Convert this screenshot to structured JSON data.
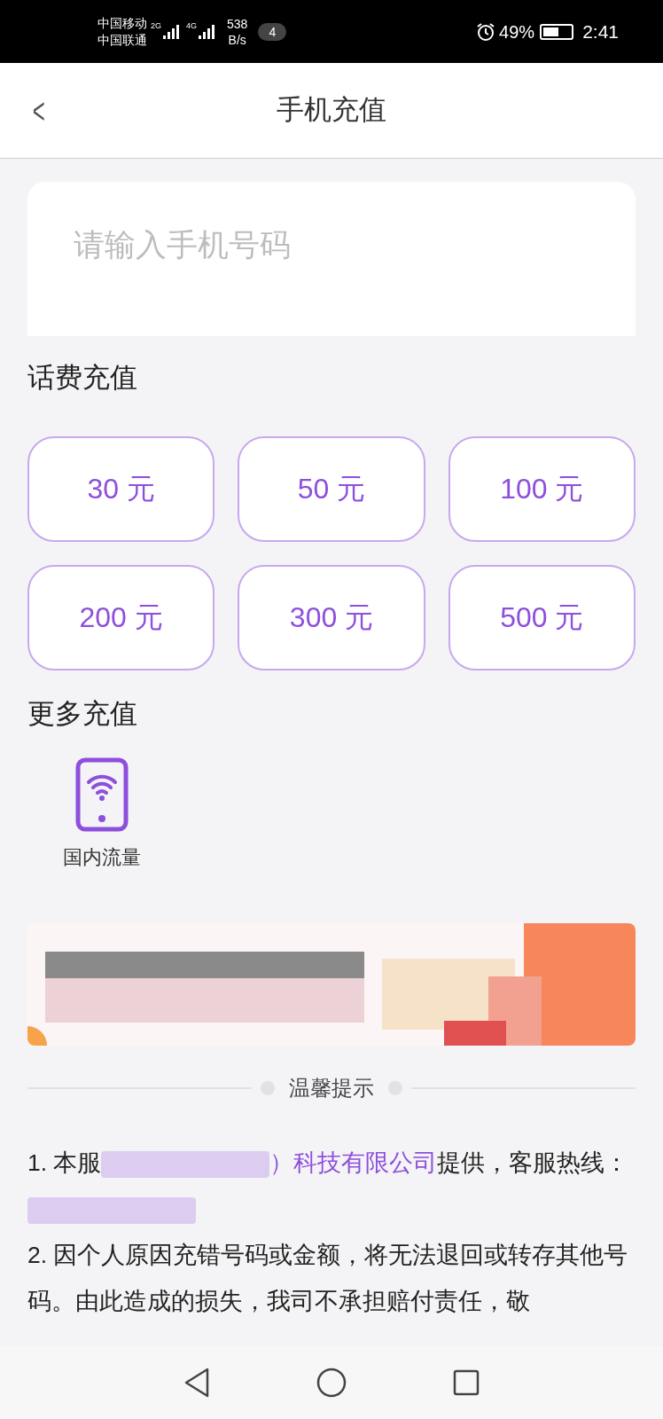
{
  "status_bar": {
    "carriers": [
      "中国移动",
      "中国联通"
    ],
    "net_1": "2G",
    "net_2": "4G",
    "speed": [
      "538",
      "B/s"
    ],
    "notifications": "4",
    "battery": "49%",
    "time": "2:41"
  },
  "header": {
    "back": "<",
    "title": "手机充值"
  },
  "phone_input": {
    "placeholder": "请输入手机号码"
  },
  "bill_section": {
    "title": "话费充值",
    "amounts": [
      {
        "label": "30 元",
        "selected": false
      },
      {
        "label": "50 元",
        "selected": false
      },
      {
        "label": "100 元",
        "selected": false
      },
      {
        "label": "200 元",
        "selected": false
      },
      {
        "label": "300 元",
        "selected": false
      },
      {
        "label": "500 元",
        "selected": false
      }
    ]
  },
  "more_section": {
    "title": "更多充值",
    "items": [
      {
        "label": "国内流量"
      }
    ]
  },
  "tips": {
    "title": "温馨提示",
    "note_1": [
      {
        "kind": "text",
        "text": "1. 本服"
      },
      {
        "kind": "redacted"
      },
      {
        "kind": "link",
        "text": "）科技有限公司"
      },
      {
        "kind": "text",
        "text": "提供，客服"
      },
      {
        "kind": "text",
        "text": "热线："
      },
      {
        "kind": "redacted"
      }
    ],
    "note_2": "2. 因个人原因充错号码或金额，将无法退回或转存其他号码。由此造成的损失，我司不承担赔付责任，敬"
  }
}
